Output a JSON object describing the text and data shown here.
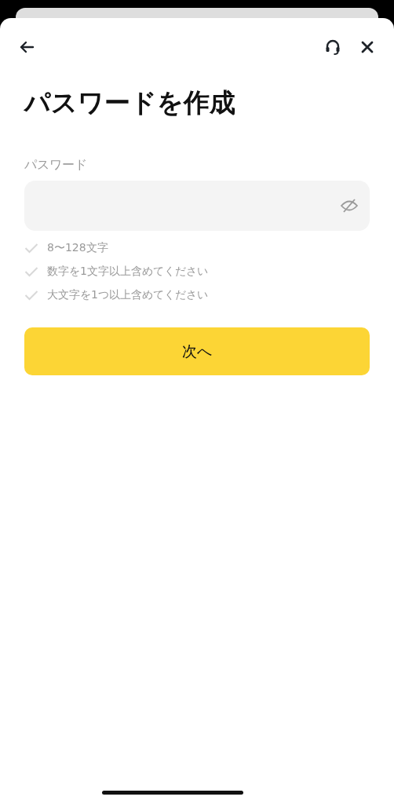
{
  "title": "パスワードを作成",
  "password": {
    "label": "パスワード",
    "masked": true
  },
  "rules": [
    {
      "text": "8〜128文字",
      "met": false
    },
    {
      "text": "数字を1文字以上含めてください",
      "met": false
    },
    {
      "text": "大文字を1つ以上含めてください",
      "met": false
    }
  ],
  "next_button": {
    "label": "次へ"
  }
}
